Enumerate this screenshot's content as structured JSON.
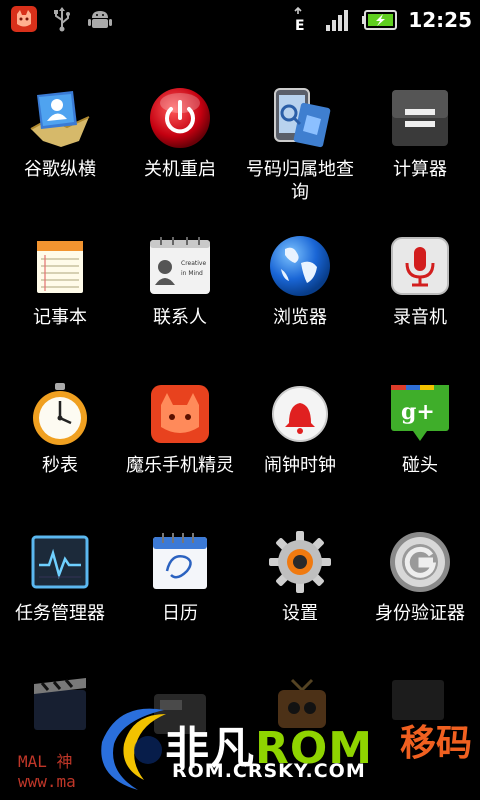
{
  "status_bar": {
    "time": "12:25",
    "network_type": "E",
    "left_icons": [
      "app-notification-icon",
      "usb-icon",
      "android-debug-icon"
    ],
    "right_icons": [
      "network-type-icon",
      "signal-strength-icon",
      "battery-charging-icon"
    ]
  },
  "apps": [
    {
      "label": "谷歌纵横",
      "icon": "google-latitude-icon"
    },
    {
      "label": "关机重启",
      "icon": "power-reboot-icon"
    },
    {
      "label": "号码归属地查询",
      "icon": "phone-location-lookup-icon"
    },
    {
      "label": "计算器",
      "icon": "calculator-icon"
    },
    {
      "label": "记事本",
      "icon": "notepad-icon"
    },
    {
      "label": "联系人",
      "icon": "contacts-icon"
    },
    {
      "label": "浏览器",
      "icon": "browser-globe-icon"
    },
    {
      "label": "录音机",
      "icon": "voice-recorder-icon"
    },
    {
      "label": "秒表",
      "icon": "stopwatch-icon"
    },
    {
      "label": "魔乐手机精灵",
      "icon": "mole-assistant-icon"
    },
    {
      "label": "闹钟时钟",
      "icon": "alarm-clock-icon"
    },
    {
      "label": "碰头",
      "icon": "google-plus-icon"
    },
    {
      "label": "任务管理器",
      "icon": "task-manager-icon"
    },
    {
      "label": "日历",
      "icon": "calendar-icon"
    },
    {
      "label": "设置",
      "icon": "settings-gear-icon"
    },
    {
      "label": "身份验证器",
      "icon": "authenticator-icon"
    }
  ],
  "partial_row_icons": [
    "movie-studio-icon",
    "fm-radio-icon",
    "tv-icon",
    "dark-app-icon"
  ],
  "watermark": {
    "brand_cn": "非凡",
    "brand_rom": "ROM",
    "url": "ROM.CRSKY.COM",
    "small_text": "MAL 神",
    "small_url": "www.ma",
    "tail": "移码"
  },
  "colors": {
    "background": "#000000",
    "text": "#ffffff",
    "battery_green": "#5fcf1f",
    "watermark_green": "#8fd400"
  }
}
